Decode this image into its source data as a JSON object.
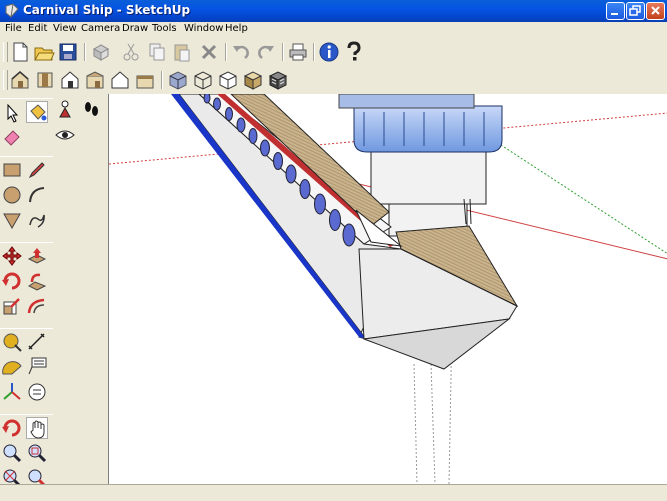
{
  "window": {
    "title": "Carnival Ship - SketchUp"
  },
  "menu": [
    "File",
    "Edit",
    "View",
    "Camera",
    "Draw",
    "Tools",
    "Window",
    "Help"
  ],
  "icons": {
    "standard": [
      "new-icon",
      "open-icon",
      "save-icon",
      "make-component-icon",
      "cut-icon",
      "copy-icon",
      "paste-icon",
      "erase-icon",
      "undo-icon",
      "redo-icon",
      "print-icon",
      "model-info-icon",
      "help-icon"
    ],
    "views": [
      "iso-view-icon",
      "top-view-icon",
      "front-view-icon",
      "right-view-icon",
      "back-view-icon",
      "left-view-icon",
      "xray-icon",
      "wireframe-icon",
      "hidden-line-icon",
      "shaded-icon",
      "shaded-textures-icon"
    ]
  },
  "colors": {
    "titlebar": "#0554e3",
    "hull_stripe": "#1a36c8",
    "deck_stripe": "#c0392b",
    "window_glass": "#7fa8e8"
  }
}
